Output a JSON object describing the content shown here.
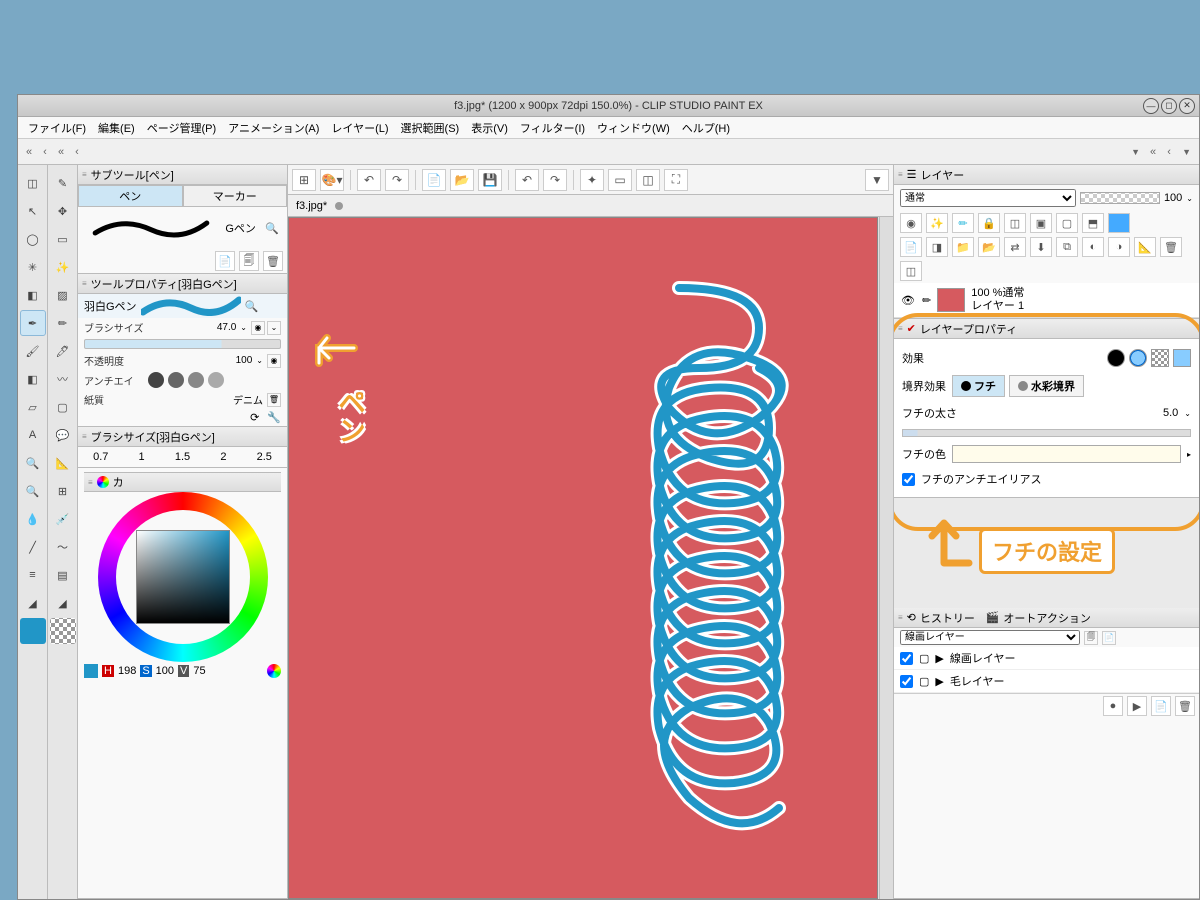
{
  "window": {
    "title": "f3.jpg* (1200 x 900px 72dpi 150.0%)  - CLIP STUDIO PAINT EX",
    "menus": [
      "ファイル(F)",
      "編集(E)",
      "ページ管理(P)",
      "アニメーション(A)",
      "レイヤー(L)",
      "選択範囲(S)",
      "表示(V)",
      "フィルター(I)",
      "ウィンドウ(W)",
      "ヘルプ(H)"
    ],
    "doc_tab": "f3.jpg*"
  },
  "subtool": {
    "panel_title": "サブツール[ペン]",
    "tabs": {
      "pen": "ペン",
      "marker": "マーカー"
    },
    "brush_name": "Gペン"
  },
  "tool_property": {
    "panel_title": "ツールプロパティ[羽白Gペン]",
    "current_tool": "羽白Gペン",
    "brush_size_label": "ブラシサイズ",
    "brush_size_value": "47.0",
    "opacity_label": "不透明度",
    "opacity_value": "100",
    "antialias_label": "アンチエイ",
    "paper_label": "紙質",
    "paper_value": "デニム"
  },
  "brush_size_list": {
    "panel_title": "ブラシサイズ[羽白Gペン]",
    "sizes": [
      "0.7",
      "1",
      "1.5",
      "2",
      "2.5"
    ]
  },
  "color_panel": {
    "panel_title": "カ",
    "readout": {
      "h_label": "H",
      "h": "198",
      "s_label": "S",
      "s": "100",
      "v_label": "V",
      "v": "75"
    }
  },
  "layer_panel": {
    "title": "レイヤー",
    "mode": "通常",
    "opacity": "100",
    "layers": [
      {
        "opacity": "100 %通常",
        "name": "レイヤー 1"
      }
    ]
  },
  "layer_prop": {
    "title": "レイヤープロパティ",
    "effect_label": "効果",
    "border_effect_label": "境界効果",
    "border_opt_edge": "フチ",
    "border_opt_water": "水彩境界",
    "thickness_label": "フチの太さ",
    "thickness_value": "5.0",
    "color_label": "フチの色",
    "aa_label": "フチのアンチエイリアス"
  },
  "history": {
    "tab_history": "ヒストリー",
    "tab_auto": "オートアクション",
    "dropdown": "線画レイヤー",
    "items": [
      "線画レイヤー",
      "毛レイヤー"
    ]
  },
  "annotations": {
    "pen": "ペン",
    "settings": "フチの設定"
  }
}
